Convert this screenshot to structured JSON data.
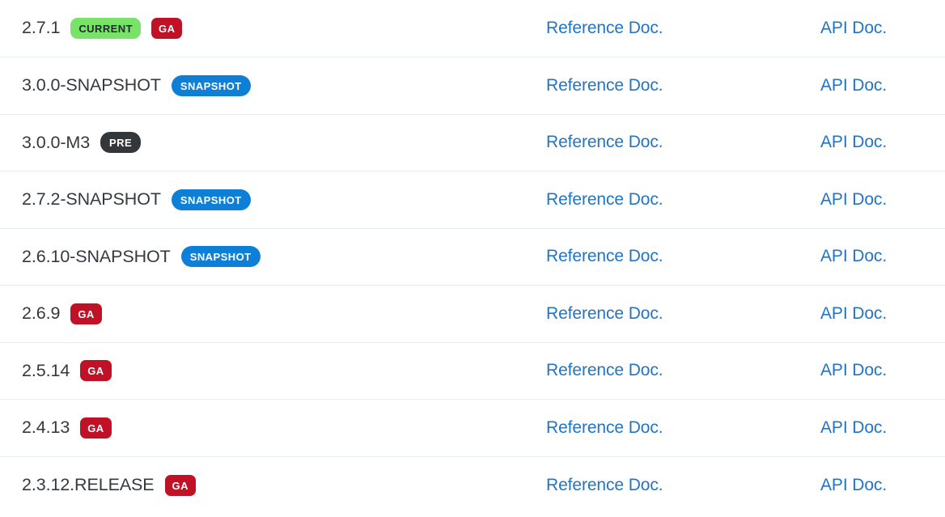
{
  "table": {
    "columns": [
      "version",
      "reference_doc",
      "api_doc"
    ],
    "reference_doc_label": "Reference Doc.",
    "api_doc_label": "API Doc.",
    "link_color": "#2274c4",
    "divider_color": "#e7ecef",
    "badge_colors": {
      "current_bg": "#78e368",
      "current_text": "#23292e",
      "ga_bg": "#c01126",
      "ga_text": "#ffffff",
      "snapshot_bg": "#0d7fd6",
      "snapshot_text": "#ffffff",
      "pre_bg": "#33373a",
      "pre_text": "#ffffff"
    },
    "rows": [
      {
        "version": "2.7.1",
        "badges": [
          {
            "label": "CURRENT",
            "kind": "current"
          },
          {
            "label": "GA",
            "kind": "ga"
          }
        ],
        "reference_doc": "Reference Doc.",
        "api_doc": "API Doc."
      },
      {
        "version": "3.0.0-SNAPSHOT",
        "badges": [
          {
            "label": "SNAPSHOT",
            "kind": "snapshot"
          }
        ],
        "reference_doc": "Reference Doc.",
        "api_doc": "API Doc."
      },
      {
        "version": "3.0.0-M3",
        "badges": [
          {
            "label": "PRE",
            "kind": "pre"
          }
        ],
        "reference_doc": "Reference Doc.",
        "api_doc": "API Doc."
      },
      {
        "version": "2.7.2-SNAPSHOT",
        "badges": [
          {
            "label": "SNAPSHOT",
            "kind": "snapshot"
          }
        ],
        "reference_doc": "Reference Doc.",
        "api_doc": "API Doc."
      },
      {
        "version": "2.6.10-SNAPSHOT",
        "badges": [
          {
            "label": "SNAPSHOT",
            "kind": "snapshot"
          }
        ],
        "reference_doc": "Reference Doc.",
        "api_doc": "API Doc."
      },
      {
        "version": "2.6.9",
        "badges": [
          {
            "label": "GA",
            "kind": "ga"
          }
        ],
        "reference_doc": "Reference Doc.",
        "api_doc": "API Doc."
      },
      {
        "version": "2.5.14",
        "badges": [
          {
            "label": "GA",
            "kind": "ga"
          }
        ],
        "reference_doc": "Reference Doc.",
        "api_doc": "API Doc."
      },
      {
        "version": "2.4.13",
        "badges": [
          {
            "label": "GA",
            "kind": "ga"
          }
        ],
        "reference_doc": "Reference Doc.",
        "api_doc": "API Doc."
      },
      {
        "version": "2.3.12.RELEASE",
        "badges": [
          {
            "label": "GA",
            "kind": "ga"
          }
        ],
        "reference_doc": "Reference Doc.",
        "api_doc": "API Doc."
      }
    ]
  }
}
